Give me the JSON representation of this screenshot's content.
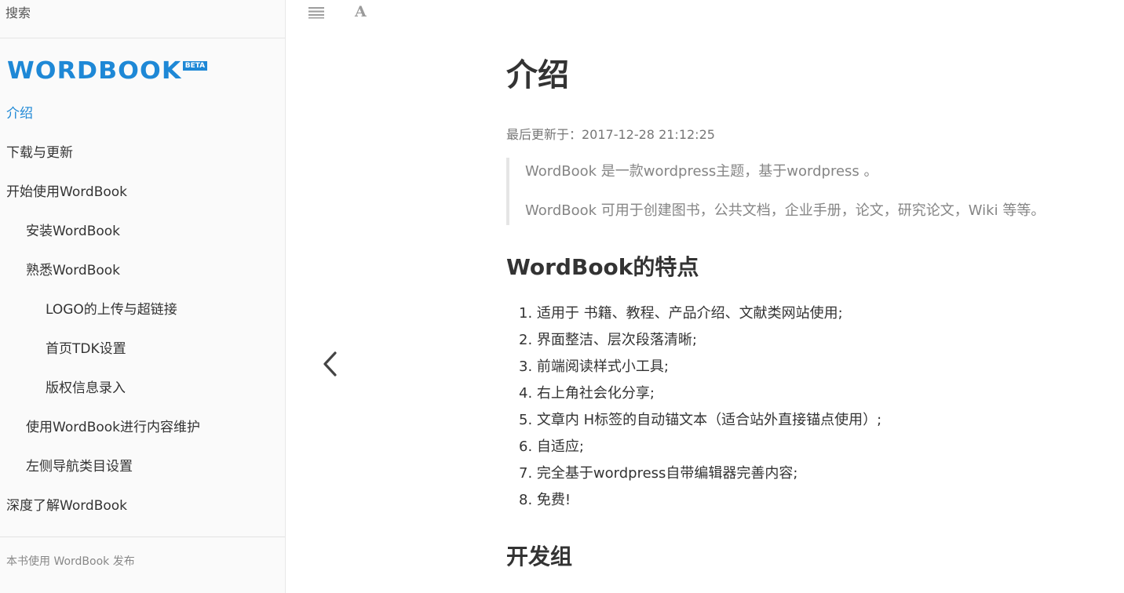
{
  "search": {
    "placeholder": "搜索"
  },
  "logo": {
    "text": "WORDBOOK",
    "badge": "BETA"
  },
  "sidebar": {
    "items": [
      {
        "label": "介绍"
      },
      {
        "label": "下载与更新"
      },
      {
        "label": "开始使用WordBook"
      },
      {
        "label": "安装WordBook"
      },
      {
        "label": "熟悉WordBook"
      },
      {
        "label": "LOGO的上传与超链接"
      },
      {
        "label": "首页TDK设置"
      },
      {
        "label": "版权信息录入"
      },
      {
        "label": "使用WordBook进行内容维护"
      },
      {
        "label": "左侧导航类目设置"
      },
      {
        "label": "深度了解WordBook"
      }
    ],
    "footer": "本书使用 WordBook 发布"
  },
  "toolbar": {
    "menu_icon": "menu-icon",
    "font_icon": "font-settings-icon",
    "font_glyph": "A"
  },
  "navigation": {
    "prev_icon": "chevron-left-icon"
  },
  "article": {
    "title": "介绍",
    "last_updated": "最后更新于：2017-12-28 21:12:25",
    "quote": [
      "WordBook 是一款wordpress主题，基于wordpress 。",
      "WordBook 可用于创建图书，公共文档，企业手册，论文，研究论文，Wiki 等等。"
    ],
    "features_title": "WordBook的特点",
    "features": [
      "适用于 书籍、教程、产品介绍、文献类网站使用;",
      "界面整洁、层次段落清晰;",
      "前端阅读样式小工具;",
      "右上角社会化分享;",
      "文章内 H标签的自动锚文本（适合站外直接锚点使用）;",
      "自适应;",
      "完全基于wordpress自带编辑器完善内容;",
      "免费!"
    ],
    "feature_numbers": [
      "1.",
      "2.",
      "3.",
      "4.",
      "5.",
      "6.",
      "7.",
      "8."
    ],
    "dev_group_title": "开发组"
  },
  "colors": {
    "accent": "#1e88d6",
    "sidebar_bg": "#fafafa",
    "text": "#333333",
    "muted": "#858585"
  }
}
